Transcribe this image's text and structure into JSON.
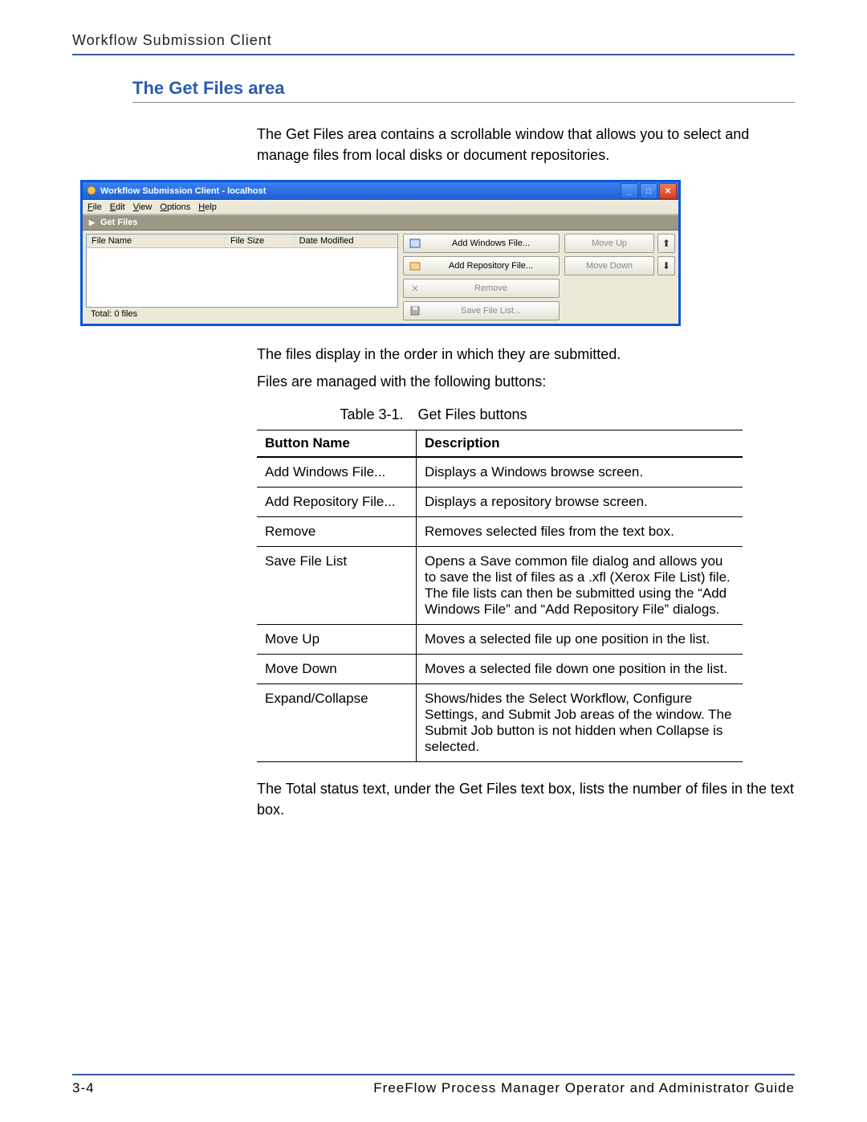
{
  "header": "Workflow Submission Client",
  "section_title": "The Get Files area",
  "intro": "The Get Files area contains a scrollable window that allows you to select and manage files from local disks or document repositories.",
  "post1": "The files display in the order in which they are submitted.",
  "post2": "Files are managed with the following buttons:",
  "table_caption": "Table 3-1. Get Files buttons",
  "closing": "The Total status text, under the Get Files text box, lists the number of files in the text box.",
  "window": {
    "title": "Workflow Submission Client - localhost",
    "menus": [
      "File",
      "Edit",
      "View",
      "Options",
      "Help"
    ],
    "sectionbar": "Get Files",
    "cols": {
      "name": "File Name",
      "size": "File Size",
      "date": "Date Modified"
    },
    "total": "Total: 0 files",
    "buttons": {
      "add_win": "Add Windows File...",
      "add_repo": "Add Repository File...",
      "remove": "Remove",
      "save": "Save File List...",
      "move_up": "Move Up",
      "move_down": "Move Down"
    }
  },
  "table": {
    "headers": {
      "name": "Button Name",
      "desc": "Description"
    },
    "rows": [
      {
        "name": "Add Windows File...",
        "desc": "Displays a Windows browse screen."
      },
      {
        "name": "Add Repository File...",
        "desc": "Displays a repository browse screen."
      },
      {
        "name": "Remove",
        "desc": "Removes selected files from the text box."
      },
      {
        "name": "Save File List",
        "desc": "Opens a Save common file dialog and allows you to save the list of files as a .xfl (Xerox File List) file. The file lists can then be submitted using the “Add Windows File” and “Add Repository File” dialogs."
      },
      {
        "name": "Move Up",
        "desc": "Moves a selected file up one position in the list."
      },
      {
        "name": "Move Down",
        "desc": "Moves a selected file down one position in the list."
      },
      {
        "name": "Expand/Collapse",
        "desc": "Shows/hides the Select Workflow, Configure Settings, and Submit Job areas of the window. The Submit Job button is not hidden when Collapse is selected."
      }
    ]
  },
  "footer": {
    "page": "3-4",
    "doc": "FreeFlow Process Manager Operator and Administrator Guide"
  }
}
